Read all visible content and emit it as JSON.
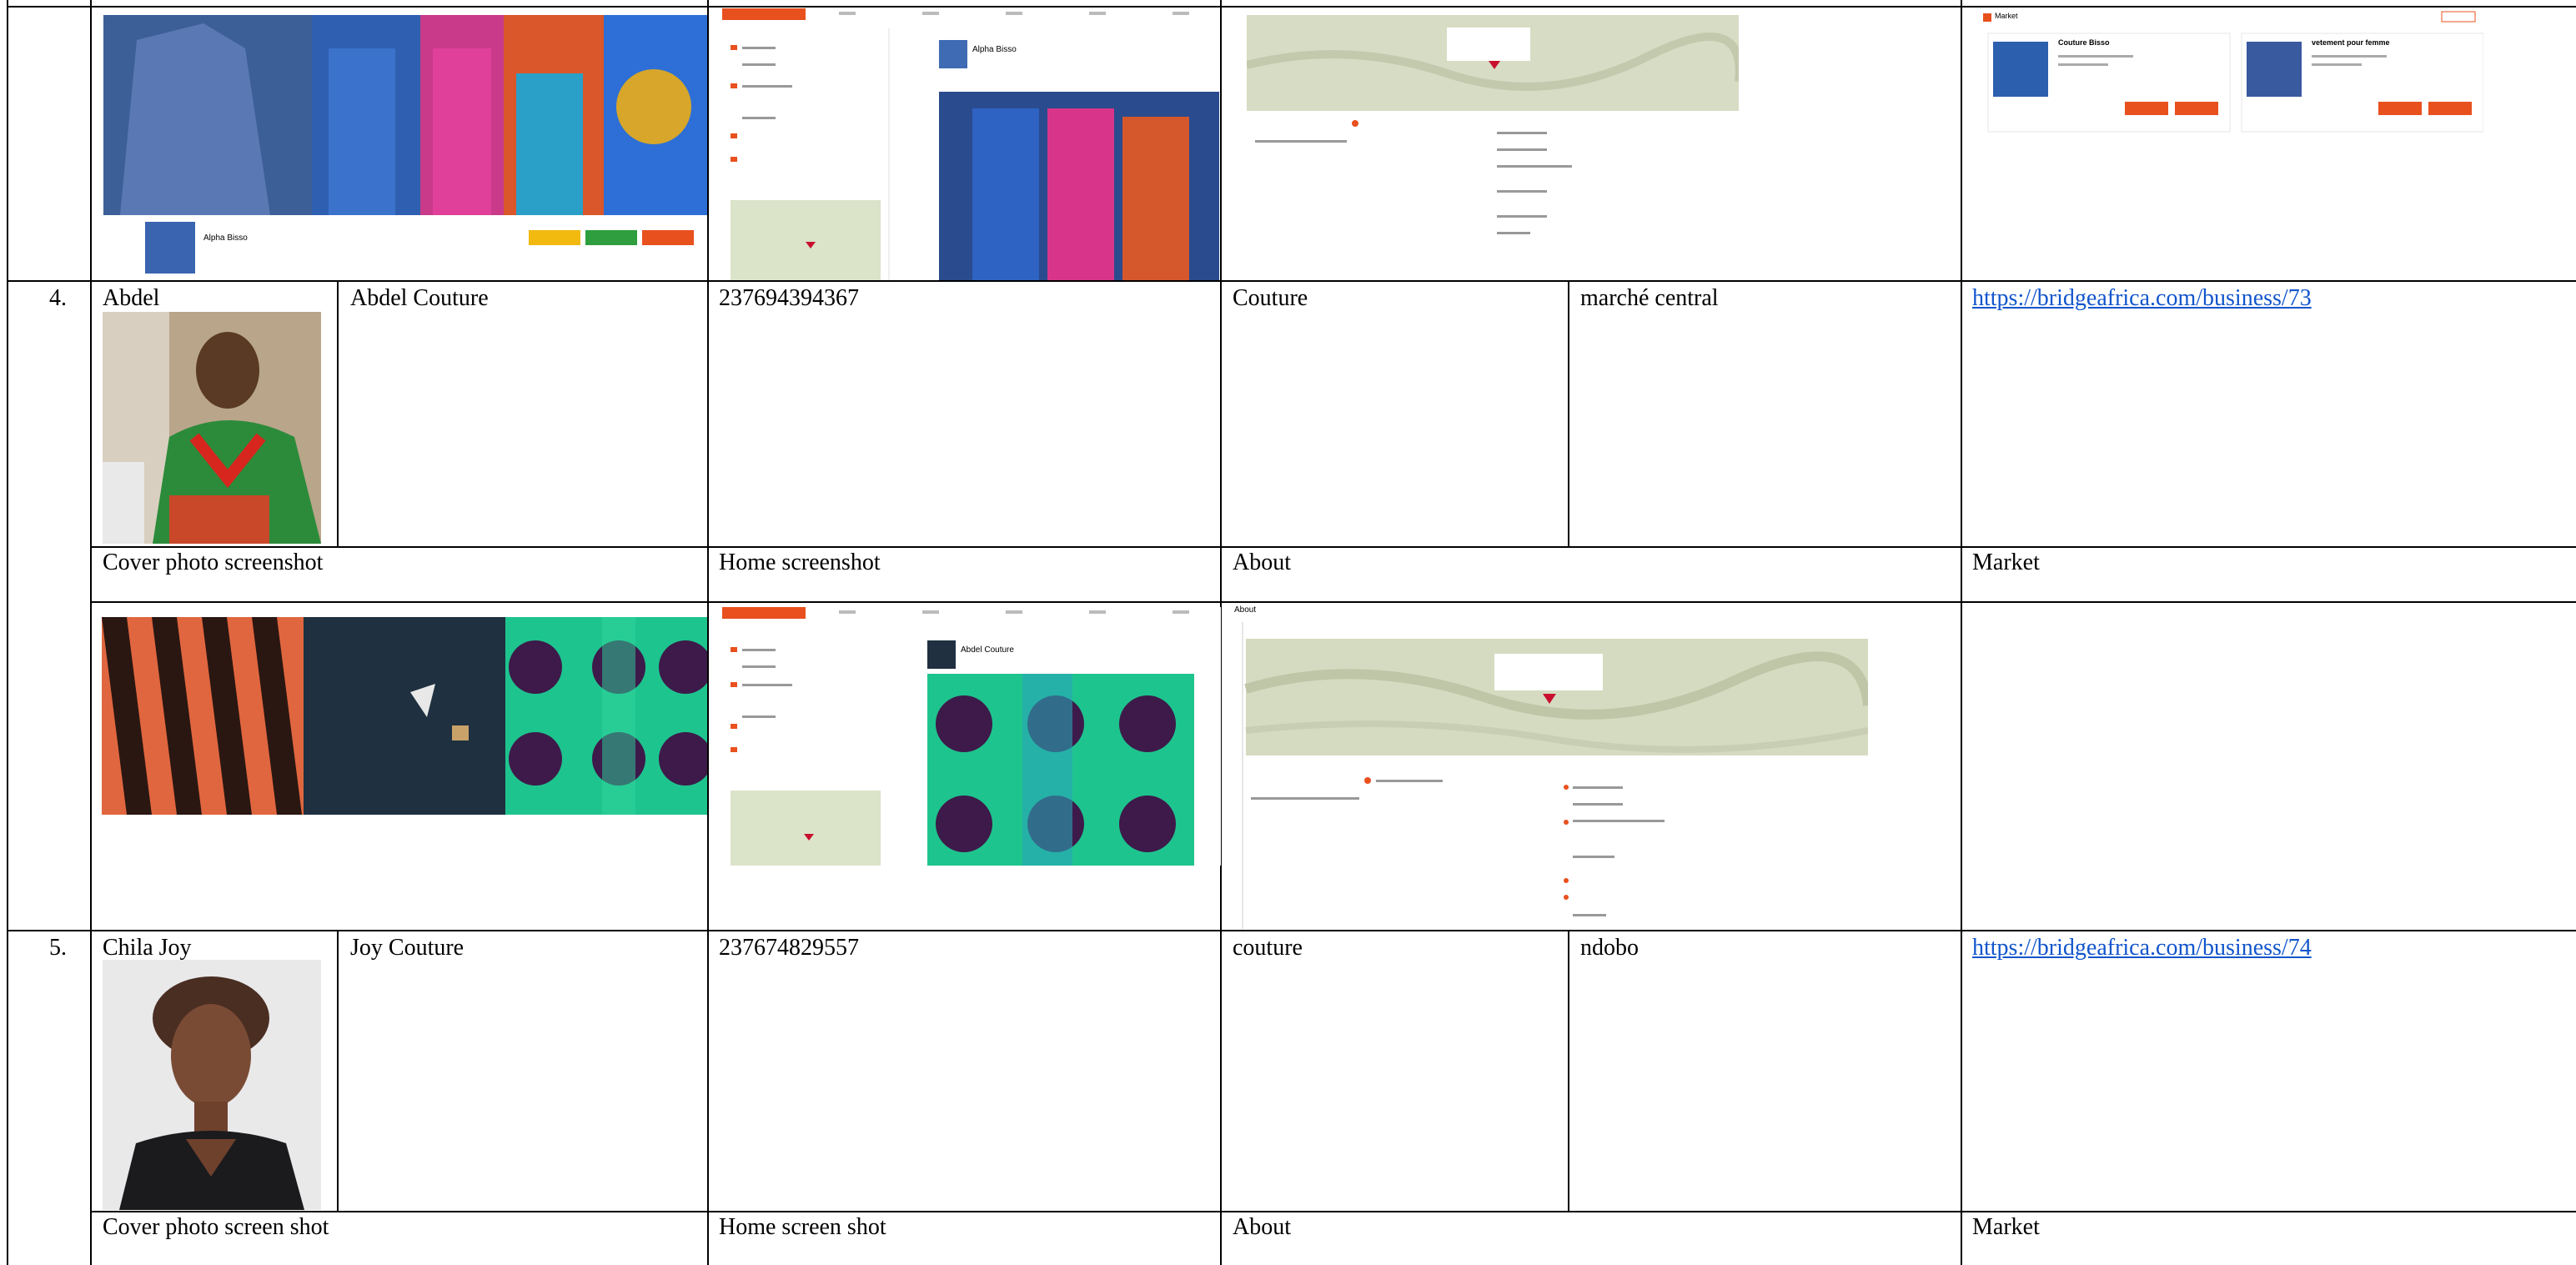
{
  "rows": [
    {
      "number": "4.",
      "name": "Abdel",
      "business": "Abdel Couture",
      "phone": "237694394367",
      "category": "Couture",
      "location": "marché central",
      "link": "https://bridgeafrica.com/business/73"
    },
    {
      "number": "5.",
      "name": "Chila Joy",
      "business": "Joy Couture",
      "phone": "237674829557",
      "category": "couture",
      "location": "ndobo",
      "link": "https://bridgeafrica.com/business/74"
    }
  ],
  "screenshot_headers_row4": {
    "cover": "Cover photo screenshot",
    "home": "Home screenshot",
    "about": "About",
    "market": "Market"
  },
  "screenshot_headers_row5": {
    "cover": "Cover photo screen shot",
    "home": "Home screen shot",
    "about": "About",
    "market": "Market"
  },
  "thumbnails": {
    "top_cover_profile_name": "Alpha Bisso",
    "top_home_profile_name": "Alpha Bisso",
    "row4_home_profile_name": "Abdel Couture",
    "row4_about_title": "About",
    "top_market_title": "Market",
    "top_market_item1": "Couture Bisso",
    "top_market_item2": "vetement pour femme"
  },
  "colors": {
    "accent_orange": "#e8501e",
    "accent_green": "#2e9e3e",
    "accent_yellow": "#f2b90f",
    "link_blue": "#1155cc"
  }
}
